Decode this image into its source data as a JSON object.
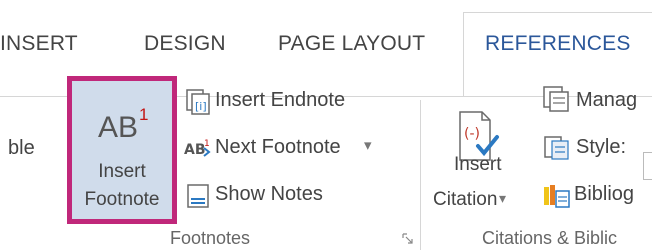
{
  "tabs": [
    {
      "label": "INSERT"
    },
    {
      "label": "DESIGN"
    },
    {
      "label": "PAGE LAYOUT"
    },
    {
      "label": "REFERENCES",
      "active": true
    }
  ],
  "ribbon": {
    "cut_left_label": "ble",
    "footnotes": {
      "insert_footnote": {
        "icon_text": "AB",
        "icon_sup": "1",
        "line1": "Insert",
        "line2": "Footnote"
      },
      "insert_endnote": "Insert Endnote",
      "next_footnote": "Next Footnote",
      "next_footnote_dropdown": "▾",
      "show_notes": "Show Notes",
      "group_label": "Footnotes"
    },
    "citations": {
      "insert_citation_line1": "Insert",
      "insert_citation_line2": "Citation",
      "insert_citation_dropdown": "▾",
      "manage": "Manag",
      "style": "Style:",
      "bibliography": "Bibliog",
      "group_label": "Citations & Biblic"
    }
  },
  "colors": {
    "active_tab": "#2b579a",
    "highlight_border": "#c0287a",
    "selected_bg": "#d0dceb",
    "footnote_red": "#c21515",
    "citation_red": "#c0392b",
    "check_blue": "#2b79c2"
  }
}
